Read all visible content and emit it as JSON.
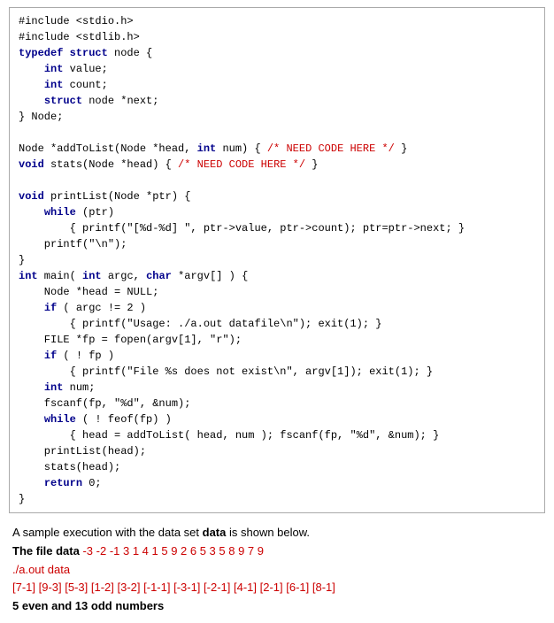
{
  "code": {
    "lines": [
      {
        "text": "#include <stdio.h>"
      },
      {
        "text": "#include <stdlib.h>"
      },
      {
        "text": "typedef struct node {"
      },
      {
        "text": "    int value;"
      },
      {
        "text": "    int count;"
      },
      {
        "text": "    struct node *next;"
      },
      {
        "text": "} Node;"
      },
      {
        "text": ""
      },
      {
        "text": "Node *addToList(Node *head, int num) { /* NEED CODE HERE */ }",
        "has_comment": true,
        "pre": "Node *addToList(Node *head, int num) { ",
        "comment": "/* NEED CODE HERE */",
        "post": " }"
      },
      {
        "text": "void stats(Node *head) { /* NEED CODE HERE */ }",
        "has_comment": true,
        "pre": "void stats(Node *head) { ",
        "comment": "/* NEED CODE HERE */",
        "post": " }"
      },
      {
        "text": ""
      },
      {
        "text": "void printList(Node *ptr) {"
      },
      {
        "text": "    while (ptr)"
      },
      {
        "text": "        { printf(\"[%d-%d] \", ptr->value, ptr->count); ptr=ptr->next; }"
      },
      {
        "text": "    printf(\"\\n\");"
      },
      {
        "text": "}"
      },
      {
        "text": "int main( int argc, char *argv[] ) {"
      },
      {
        "text": "    Node *head = NULL;"
      },
      {
        "text": "    if ( argc != 2 )"
      },
      {
        "text": "        { printf(\"Usage: ./a.out datafile\\n\"); exit(1); }"
      },
      {
        "text": "    FILE *fp = fopen(argv[1], \"r\");"
      },
      {
        "text": "    if ( ! fp )"
      },
      {
        "text": "        { printf(\"File %s does not exist\\n\", argv[1]); exit(1); }"
      },
      {
        "text": "    int num;"
      },
      {
        "text": "    fscanf(fp, \"%d\", &num);"
      },
      {
        "text": "    while ( ! feof(fp) )"
      },
      {
        "text": "        { head = addToList( head, num ); fscanf(fp, \"%d\", &num); }"
      },
      {
        "text": "    printList(head);"
      },
      {
        "text": "    stats(head);"
      },
      {
        "text": "    return 0;"
      },
      {
        "text": "}"
      }
    ]
  },
  "description": {
    "line1": "A sample execution with the data set ",
    "line1_bold": "data",
    "line1_end": " is shown below.",
    "line2_pre": "The file data",
    "line2_data": "  -3 -2 -1 3 1 4 1 5 9 2 6 5 3 5 8 9 7 9",
    "line3": "./a.out data",
    "line4": "[7-1] [9-3] [5-3] [1-2] [3-2] [-1-1] [-3-1] [-2-1] [4-1] [2-1] [6-1] [8-1]",
    "line5": "5 even and 13 odd numbers"
  }
}
